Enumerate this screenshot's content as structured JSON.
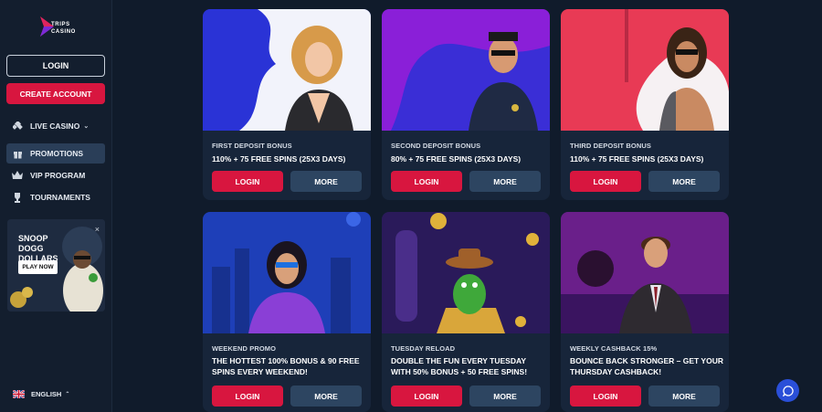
{
  "brand": {
    "logo_line1": "TRIPS",
    "logo_line2": "CASINO"
  },
  "sidebar": {
    "login_label": "LOGIN",
    "create_account_label": "CREATE ACCOUNT",
    "items": [
      {
        "label": "LIVE CASINO",
        "icon": "diamond-icon"
      },
      {
        "label": "PROMOTIONS",
        "icon": "gift-icon",
        "active": true
      },
      {
        "label": "VIP PROGRAM",
        "icon": "crown-icon"
      },
      {
        "label": "TOURNAMENTS",
        "icon": "trophy-icon"
      }
    ],
    "banner": {
      "title": "SNOOP DOGG DOLLARS",
      "cta": "PLAY NOW",
      "close": "×"
    },
    "language": "ENGLISH"
  },
  "cards": [
    {
      "category": "FIRST DEPOSIT BONUS",
      "title": "110% + 75 FREE SPINS (25X3 DAYS)",
      "login": "LOGIN",
      "more": "MORE"
    },
    {
      "category": "SECOND DEPOSIT BONUS",
      "title": "80% + 75 FREE SPINS (25X3 DAYS)",
      "login": "LOGIN",
      "more": "MORE"
    },
    {
      "category": "THIRD DEPOSIT BONUS",
      "title": "110% + 75 FREE SPINS (25X3 DAYS)",
      "login": "LOGIN",
      "more": "MORE"
    },
    {
      "category": "WEEKEND PROMO",
      "title": "THE HOTTEST 100% BONUS & 90 FREE SPINS EVERY WEEKEND!",
      "login": "LOGIN",
      "more": "MORE"
    },
    {
      "category": "TUESDAY RELOAD",
      "title": "DOUBLE THE FUN EVERY TUESDAY WITH 50% BONUS + 50 FREE SPINS!",
      "login": "LOGIN",
      "more": "MORE"
    },
    {
      "category": "WEEKLY CASHBACK 15%",
      "title": "BOUNCE BACK STRONGER – GET YOUR THURSDAY CASHBACK!",
      "login": "LOGIN",
      "more": "MORE"
    }
  ],
  "colors": {
    "accent": "#d8163f",
    "secondary_button": "#2d4561",
    "background": "#101b2b",
    "chat": "#2a4fd8"
  }
}
